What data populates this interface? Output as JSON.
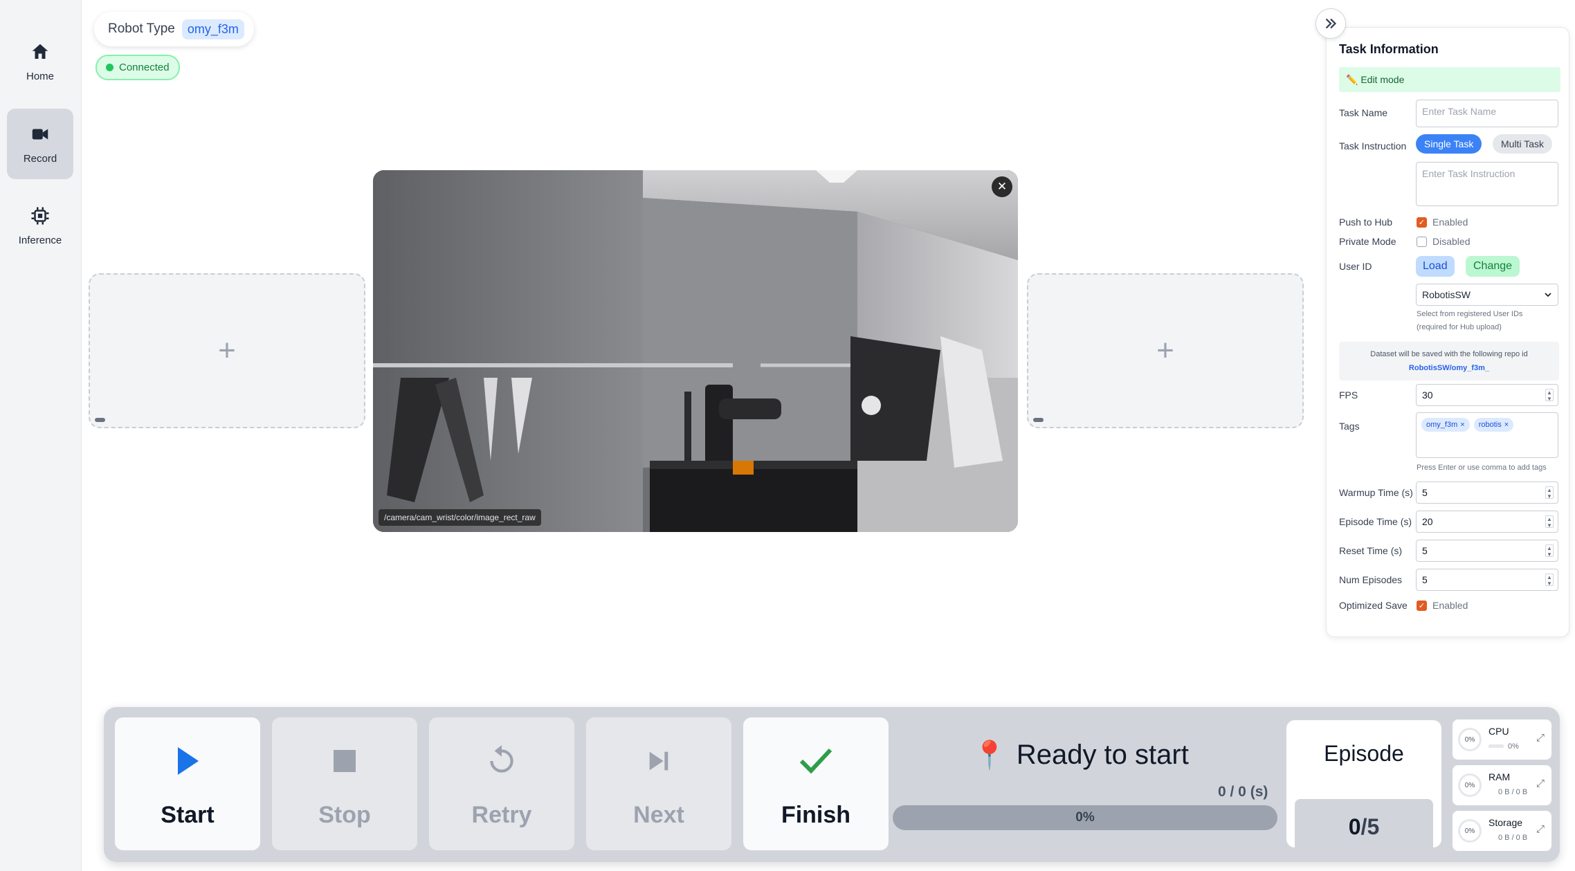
{
  "sidebar": {
    "items": [
      {
        "label": "Home",
        "icon": "home-icon",
        "active": false
      },
      {
        "label": "Record",
        "icon": "video-camera-icon",
        "active": true
      },
      {
        "label": "Inference",
        "icon": "chip-icon",
        "active": false
      }
    ]
  },
  "header": {
    "robot_type_label": "Robot Type",
    "robot_type_value": "omy_f3m",
    "connection_status": "Connected"
  },
  "camera": {
    "topic": "/camera/cam_wrist/color/image_rect_raw",
    "add_slot_symbol": "+",
    "close_symbol": "✕"
  },
  "task_panel": {
    "title": "Task Information",
    "edit_mode": "✏️ Edit mode",
    "task_name_label": "Task Name",
    "task_name_placeholder": "Enter Task Name",
    "task_instruction_label": "Task Instruction",
    "single_task": "Single Task",
    "multi_task": "Multi Task",
    "task_instruction_placeholder": "Enter Task Instruction",
    "push_to_hub_label": "Push to Hub",
    "push_to_hub_value": "Enabled",
    "push_to_hub_checked": true,
    "private_mode_label": "Private Mode",
    "private_mode_value": "Disabled",
    "private_mode_checked": false,
    "user_id_label": "User ID",
    "load_button": "Load",
    "change_button": "Change",
    "user_id_selected": "RobotisSW",
    "user_id_hint_1": "Select from registered User IDs",
    "user_id_hint_2": "(required for Hub upload)",
    "repo_note": "Dataset will be saved with the following repo id",
    "repo_id": "RobotisSW/omy_f3m_",
    "fps_label": "FPS",
    "fps_value": "30",
    "tags_label": "Tags",
    "tags": [
      "omy_f3m",
      "robotis"
    ],
    "tag_remove": "×",
    "tags_hint": "Press Enter or use comma to add tags",
    "warmup_label": "Warmup Time (s)",
    "warmup_value": "5",
    "episode_time_label": "Episode Time (s)",
    "episode_time_value": "20",
    "reset_time_label": "Reset Time (s)",
    "reset_time_value": "5",
    "num_episodes_label": "Num Episodes",
    "num_episodes_value": "5",
    "optimized_save_label": "Optimized Save",
    "optimized_save_value": "Enabled",
    "optimized_save_checked": true
  },
  "controls": {
    "start": "Start",
    "stop": "Stop",
    "retry": "Retry",
    "next": "Next",
    "finish": "Finish",
    "status": "Ready to start",
    "status_icon": "📍",
    "time": "0 / 0 (s)",
    "progress_percent": 0,
    "progress_label": "0%",
    "episode_title": "Episode",
    "episode_current": "0",
    "episode_total": "/5"
  },
  "system": {
    "cpu": {
      "name": "CPU",
      "percent": "0%",
      "sub": "0%"
    },
    "ram": {
      "name": "RAM",
      "percent": "0%",
      "sub": "0 B / 0 B"
    },
    "storage": {
      "name": "Storage",
      "percent": "0%",
      "sub": "0 B / 0 B"
    }
  },
  "colors": {
    "accent": "#3b82f6",
    "success": "#22c55e",
    "play_blue": "#1a73e8",
    "finish_green": "#2e9d4a",
    "checkbox_orange": "#e25c22"
  }
}
